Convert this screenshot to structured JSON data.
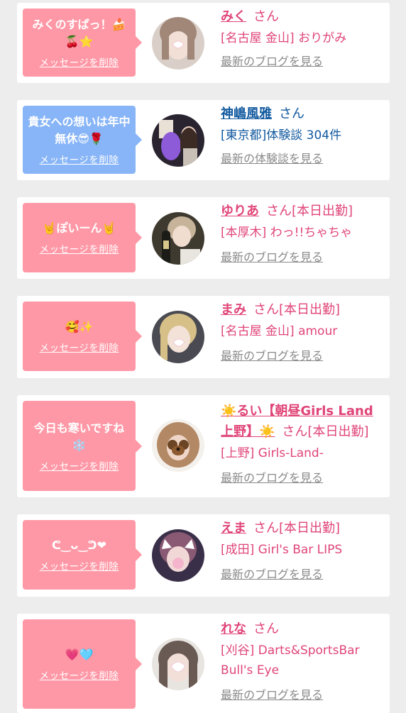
{
  "entries": [
    {
      "message": "みくのすぱっ！🍰 🍒⭐",
      "delete_label": "メッセージを削除",
      "name": "みく",
      "suffix": "さん",
      "status": "",
      "area": "[名古屋 金山] おりがみ",
      "link_label": "最新のブログを見る",
      "theme": "pink"
    },
    {
      "message": "貴女への想いは年中無休😎🌹",
      "delete_label": "メッセージを削除",
      "name": "神嶋風雅",
      "suffix": "さん",
      "status": "",
      "area": "[東京都]体験談 304件",
      "link_label": "最新の体験談を見る",
      "theme": "blue"
    },
    {
      "message": "🤘ぽいーん🤘",
      "delete_label": "メッセージを削除",
      "name": "ゆりあ",
      "suffix": "さん",
      "status": "[本日出勤]",
      "area": "[本厚木] わっ!!ちゃちゃ",
      "link_label": "最新のブログを見る",
      "theme": "pink"
    },
    {
      "message": "🥰✨",
      "delete_label": "メッセージを削除",
      "name": "まみ",
      "suffix": "さん",
      "status": "[本日出勤]",
      "area": "[名古屋 金山] amour",
      "link_label": "最新のブログを見る",
      "theme": "pink"
    },
    {
      "message": "今日も寒いですね❄️",
      "delete_label": "メッセージを削除",
      "name": "☀️るい【朝昼Girls Land上野】☀️",
      "suffix": "さん",
      "status": "[本日出勤]",
      "area": "[上野] Girls-Land-",
      "link_label": "最新のブログを見る",
      "theme": "pink"
    },
    {
      "message": "ᕦ‿ᴗ‿ᕤ❤",
      "delete_label": "メッセージを削除",
      "name": "えま",
      "suffix": "さん",
      "status": "[本日出勤]",
      "area": "[成田] Girl's Bar LIPS",
      "link_label": "最新のブログを見る",
      "theme": "pink"
    },
    {
      "message": "💗🩵",
      "delete_label": "メッセージを削除",
      "name": "れな",
      "suffix": "さん",
      "status": "",
      "area": "[刈谷] Darts&SportsBar Bull's Eye",
      "link_label": "最新のブログを見る",
      "theme": "pink"
    }
  ]
}
